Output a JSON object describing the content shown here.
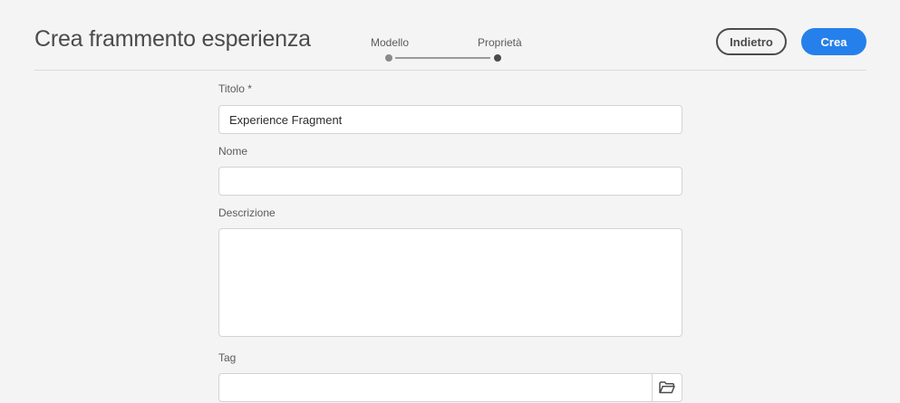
{
  "header": {
    "title": "Crea frammento esperienza",
    "back_label": "Indietro",
    "create_label": "Crea"
  },
  "stepper": {
    "steps": [
      {
        "label": "Modello",
        "state": "completed"
      },
      {
        "label": "Proprietà",
        "state": "current"
      }
    ]
  },
  "form": {
    "title_field": {
      "label": "Titolo *",
      "value": "Experience Fragment"
    },
    "name_field": {
      "label": "Nome",
      "value": ""
    },
    "description_field": {
      "label": "Descrizione",
      "value": ""
    },
    "tag_field": {
      "label": "Tag",
      "value": "",
      "button_icon": "folder-icon"
    }
  },
  "colors": {
    "accent": "#2680eb",
    "background": "#f4f4f4",
    "step_current": "#4b4b4b",
    "step_completed": "#8a8a8a"
  }
}
